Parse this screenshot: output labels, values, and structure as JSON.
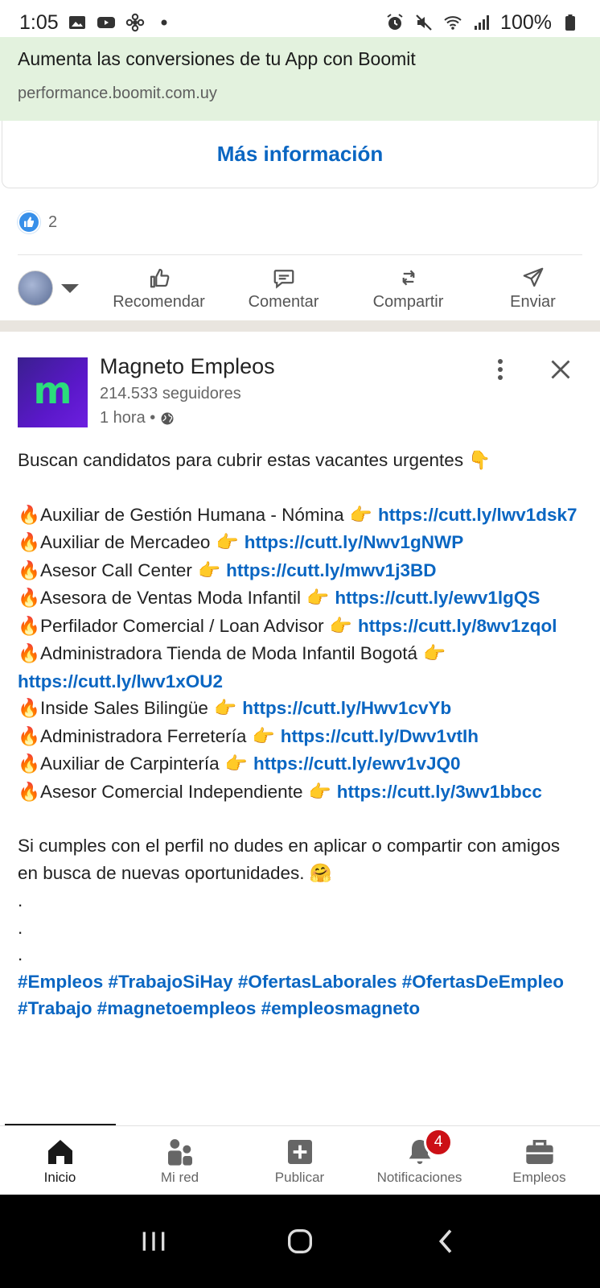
{
  "status_bar": {
    "time": "1:05",
    "battery": "100%"
  },
  "ad": {
    "title": "Aumenta las conversiones de tu App con Boomit",
    "url": "performance.boomit.com.uy",
    "cta": "Más información"
  },
  "reactions": {
    "count": "2"
  },
  "actions": {
    "recommend": "Recomendar",
    "comment": "Comentar",
    "share": "Compartir",
    "send": "Enviar"
  },
  "post": {
    "logo_letter": "m",
    "company": "Magneto Empleos",
    "followers": "214.533 seguidores",
    "time": "1 hora •",
    "intro": "Buscan candidatos para cubrir estas vacantes urgentes",
    "jobs": [
      {
        "title": "Auxiliar de Gestión Humana - Nómina",
        "link": "https://cutt.ly/lwv1dsk7"
      },
      {
        "title": "Auxiliar de Mercadeo",
        "link": "https://cutt.ly/Nwv1gNWP"
      },
      {
        "title": "Asesor Call Center",
        "link": "https://cutt.ly/mwv1j3BD"
      },
      {
        "title": "Asesora de Ventas Moda Infantil",
        "link": "https://cutt.ly/ewv1lgQS"
      },
      {
        "title": "Perfilador Comercial / Loan Advisor",
        "link": "https://cutt.ly/8wv1zqol"
      },
      {
        "title": "Administradora Tienda de Moda Infantil Bogotá",
        "link": "https://cutt.ly/lwv1xOU2"
      },
      {
        "title": "Inside Sales Bilingüe",
        "link": "https://cutt.ly/Hwv1cvYb"
      },
      {
        "title": "Administradora Ferretería",
        "link": "https://cutt.ly/Dwv1vtIh"
      },
      {
        "title": "Auxiliar de Carpintería",
        "link": "https://cutt.ly/ewv1vJQ0"
      },
      {
        "title": "Asesor Comercial Independiente",
        "link": "https://cutt.ly/3wv1bbcc"
      }
    ],
    "outro": "Si cumples con el perfil no dudes en aplicar o compartir con amigos en busca de nuevas oportunidades.",
    "dot": ".",
    "hashtags": "#Empleos #TrabajoSiHay #OfertasLaborales #OfertasDeEmpleo #Trabajo #magnetoempleos #empleosmagneto"
  },
  "bottom_nav": {
    "home": "Inicio",
    "network": "Mi red",
    "post": "Publicar",
    "notifications": "Notificaciones",
    "notifications_badge": "4",
    "jobs": "Empleos"
  },
  "colors": {
    "link": "#0a66c2",
    "ad_background": "#e3f2de",
    "badge": "#cc1016",
    "logo_background": "#5a18c9",
    "logo_letter": "#2bdc7b"
  },
  "icons": [
    "image-icon",
    "youtube-icon",
    "fan-icon",
    "alarm-icon",
    "mute-icon",
    "wifi-icon",
    "signal-icon",
    "battery-icon",
    "like-icon",
    "globe-icon",
    "more-vertical-icon",
    "close-icon",
    "home-icon",
    "network-icon",
    "plus-square-icon",
    "bell-icon",
    "briefcase-icon"
  ]
}
